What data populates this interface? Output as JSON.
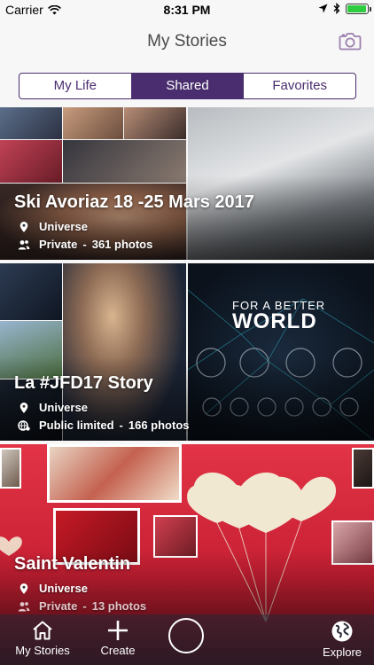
{
  "status": {
    "carrier": "Carrier",
    "time": "8:31 PM",
    "battery_level": 0.95
  },
  "header": {
    "title": "My Stories",
    "camera_icon": "camera-icon"
  },
  "tabs": [
    {
      "label": "My Life",
      "active": false
    },
    {
      "label": "Shared",
      "active": true
    },
    {
      "label": "Favorites",
      "active": false
    }
  ],
  "stories": [
    {
      "title": "Ski Avoriaz 18 -25 Mars 2017",
      "location": "Universe",
      "privacy": "Private",
      "photos": "361 photos"
    },
    {
      "title": "La #JFD17 Story",
      "location": "Universe",
      "privacy": "Public limited",
      "photos": "166 photos"
    },
    {
      "title": "Saint Valentin",
      "location": "Universe",
      "privacy": "Private",
      "photos": "13 photos"
    }
  ],
  "card2_overlay": {
    "line1": "FOR A BETTER",
    "line2": "WORLD"
  },
  "tabbar": [
    {
      "label": "My Stories",
      "icon": "home-icon"
    },
    {
      "label": "Create",
      "icon": "plus-icon"
    },
    {
      "label": "",
      "icon": "circle-icon"
    },
    {
      "label": "Explore",
      "icon": "globe-icon"
    }
  ],
  "colors": {
    "accent": "#4a2d6e",
    "background": "#f7f7f7",
    "valentine_red": "#d4243a"
  }
}
